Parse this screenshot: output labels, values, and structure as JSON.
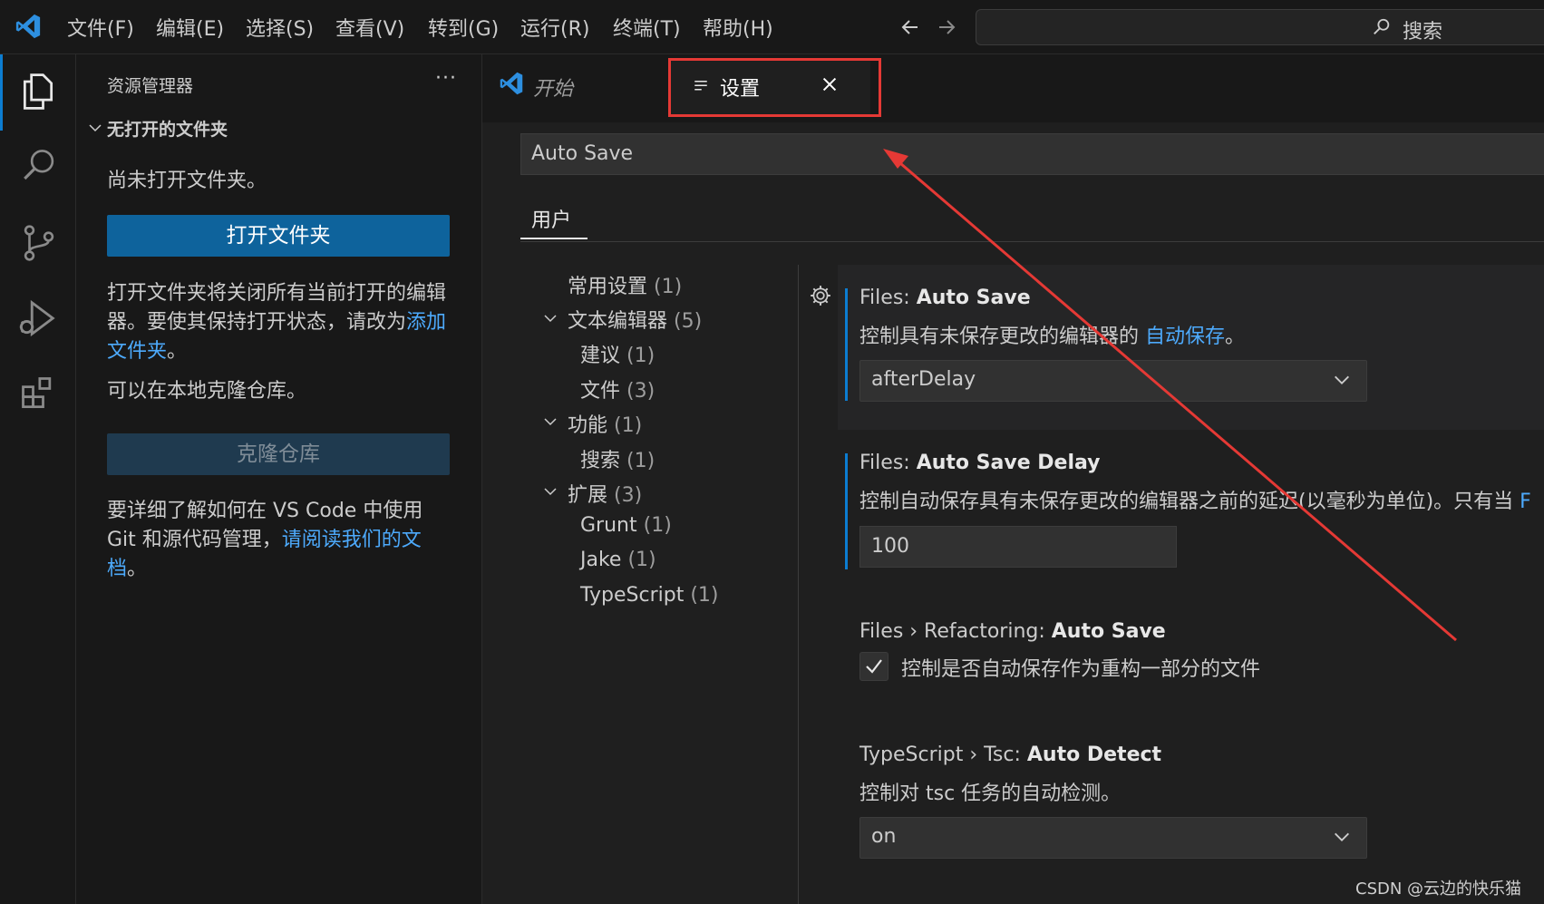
{
  "menu": [
    "文件(F)",
    "编辑(E)",
    "选择(S)",
    "查看(V)",
    "转到(G)",
    "运行(R)",
    "终端(T)",
    "帮助(H)"
  ],
  "search_label": "搜索",
  "explorer": {
    "title": "资源管理器",
    "more": "···",
    "section": "无打开的文件夹",
    "no_folder": "尚未打开文件夹。",
    "open_folder_btn": "打开文件夹",
    "open_note": "打开文件夹将关闭所有当前打开的编辑器。要使其保持打开状态，请改为",
    "add_folder_link": "添加文件夹",
    "period": "。",
    "clone_note": "可以在本地克隆仓库。",
    "clone_btn": "克隆仓库",
    "learn_note": "要详细了解如何在 VS Code 中使用 Git 和源代码管理，",
    "docs_link": "请阅读我们的文档",
    "period2": "。"
  },
  "tabs": {
    "start": "开始",
    "settings": "设置"
  },
  "settings": {
    "search_value": "Auto Save",
    "scope_tab": "用户",
    "toc": [
      {
        "label": "常用设置",
        "count": "(1)"
      },
      {
        "label": "文本编辑器",
        "count": "(5)"
      },
      {
        "label": "建议",
        "count": "(1)"
      },
      {
        "label": "文件",
        "count": "(3)"
      },
      {
        "label": "功能",
        "count": "(1)"
      },
      {
        "label": "搜索",
        "count": "(1)"
      },
      {
        "label": "扩展",
        "count": "(3)"
      },
      {
        "label": "Grunt",
        "count": "(1)"
      },
      {
        "label": "Jake",
        "count": "(1)"
      },
      {
        "label": "TypeScript",
        "count": "(1)"
      }
    ],
    "items": [
      {
        "category": "Files: ",
        "name": "Auto Save",
        "desc": "控制具有未保存更改的编辑器的 ",
        "desc_link": "自动保存",
        "desc_end": "。",
        "value": "afterDelay"
      },
      {
        "category": "Files: ",
        "name": "Auto Save Delay",
        "desc": "控制自动保存具有未保存更改的编辑器之前的延迟(以毫秒为单位)。只有当 ",
        "desc_link": "F",
        "value": "100"
      },
      {
        "category": "Files › Refactoring: ",
        "name": "Auto Save",
        "desc": "控制是否自动保存作为重构一部分的文件",
        "checked": true
      },
      {
        "category": "TypeScript › Tsc: ",
        "name": "Auto Detect",
        "desc": "控制对 tsc 任务的自动检测。",
        "value": "on"
      }
    ]
  },
  "watermark": "CSDN @云边的快乐猫",
  "colors": {
    "accent": "#0e639c",
    "link": "#4daafc",
    "annotation": "#e53935"
  }
}
